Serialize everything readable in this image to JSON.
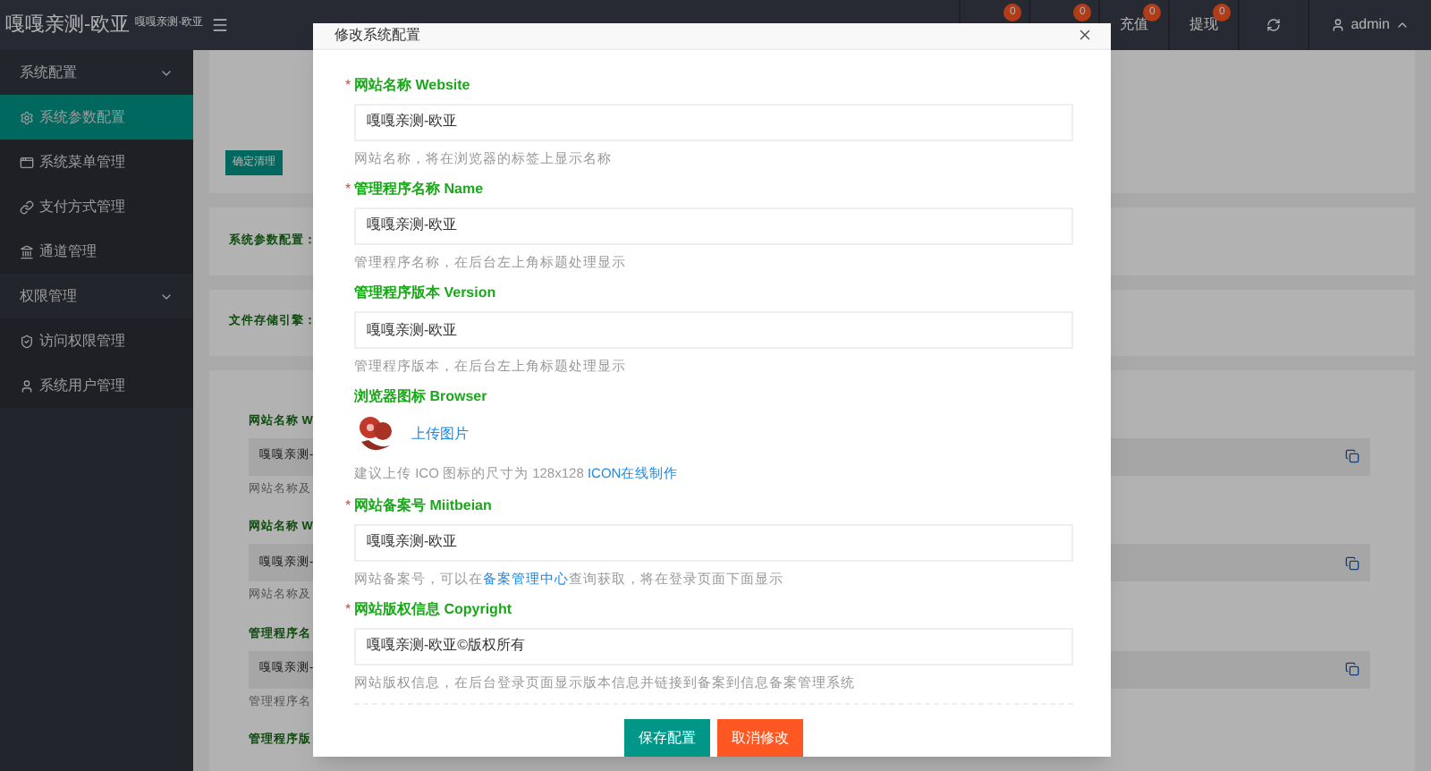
{
  "brand": {
    "title": "嘎嘎亲测-欧亚",
    "subtitle": "嘎嘎亲测·欧亚"
  },
  "topnav": {
    "items": [
      {
        "badge": "0"
      },
      {
        "badge": "0"
      },
      {
        "label": "充值",
        "badge": "0"
      },
      {
        "label": "提现",
        "badge": "0"
      }
    ],
    "user": "admin"
  },
  "sidebar": {
    "groups": [
      {
        "label": "系统配置",
        "expanded": true,
        "items": [
          {
            "label": "系统参数配置",
            "selected": true
          },
          {
            "label": "系统菜单管理",
            "selected": false
          },
          {
            "label": "支付方式管理",
            "selected": false
          },
          {
            "label": "通道管理",
            "selected": false
          }
        ]
      },
      {
        "label": "权限管理",
        "expanded": true,
        "items": [
          {
            "label": "访问权限管理",
            "selected": false
          },
          {
            "label": "系统用户管理",
            "selected": false
          }
        ]
      }
    ]
  },
  "background": {
    "clean_button": "确定清理",
    "param_label": "系统参数配置：",
    "storage_label": "文件存储引擎：",
    "settings": [
      {
        "label": "网站名称 W",
        "value": "嘎嘎亲测-",
        "hint": "网站名称及"
      },
      {
        "label": "网站名称 W",
        "value": "嘎嘎亲测-",
        "hint": "网站名称及"
      },
      {
        "label": "管理程序名",
        "value": "嘎嘎亲测-",
        "hint": "管理程序名"
      },
      {
        "label": "管理程序版"
      }
    ]
  },
  "dialog": {
    "title": "修改系统配置",
    "required_mark": "*",
    "fields": [
      {
        "kind": "text",
        "required": true,
        "label": "网站名称 Website",
        "value": "嘎嘎亲测-欧亚",
        "hint": "网站名称，将在浏览器的标签上显示名称"
      },
      {
        "kind": "text",
        "required": true,
        "label": "管理程序名称 Name",
        "value": "嘎嘎亲测-欧亚",
        "hint": "管理程序名称，在后台左上角标题处理显示"
      },
      {
        "kind": "text",
        "required": false,
        "label": "管理程序版本 Version",
        "value": "嘎嘎亲测-欧亚",
        "hint": "管理程序版本，在后台左上角标题处理显示"
      },
      {
        "kind": "image",
        "required": false,
        "label": "浏览器图标 Browser",
        "upload": "上传图片",
        "hint": "建议上传 ICO 图标的尺寸为 128x128",
        "link": "ICON在线制作"
      },
      {
        "kind": "text",
        "required": true,
        "label": "网站备案号 Miitbeian",
        "value": "嘎嘎亲测-欧亚",
        "hint": "网站备案号，可以在",
        "link": "备案管理中心",
        "hint_after": "查询获取，将在登录页面下面显示"
      },
      {
        "kind": "text",
        "required": true,
        "label": "网站版权信息 Copyright",
        "value": "嘎嘎亲测-欧亚©版权所有",
        "hint": "网站版权信息，在后台登录页面显示版本信息并链接到备案到信息备案管理系统"
      }
    ],
    "buttons": [
      {
        "kind": "primary",
        "label": "保存配置"
      },
      {
        "kind": "danger",
        "label": "取消修改"
      }
    ]
  }
}
